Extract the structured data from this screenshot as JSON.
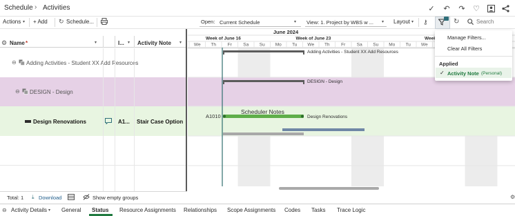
{
  "breadcrumb": {
    "root": "Schedule",
    "separator": "›",
    "current": "Activities"
  },
  "toolbar": {
    "actions": "Actions",
    "add": "+ Add",
    "scheduler": "Schedule...",
    "open_label": "Open:",
    "open_value": "Current Schedule",
    "view_value": "View: 1. Project by WBS w ...",
    "layout": "Layout",
    "search_placeholder": "Search"
  },
  "grid": {
    "col_name": "Name",
    "col_required_mark": "*",
    "col_id": "I...",
    "col_note": "Activity Note",
    "rows": [
      {
        "name": "Adding Activities - Student XX Add Resources",
        "id": "",
        "note": ""
      },
      {
        "name": "DESIGN - Design",
        "id": "",
        "note": ""
      },
      {
        "name": "Design Renovations",
        "id": "A1...",
        "note": "Stair Case Option"
      }
    ]
  },
  "gantt": {
    "month": "June 2024",
    "weeks": [
      "Week of June 16",
      "Week of June 23",
      "Week of"
    ],
    "days": [
      "We",
      "Th",
      "Fr",
      "Sa",
      "Su",
      "Mo",
      "Tu",
      "We",
      "Th",
      "Fr",
      "Sa",
      "Su",
      "Mo",
      "Tu",
      "We",
      "Th",
      "Fr",
      "Sa",
      "Su",
      "Mo"
    ],
    "labels": {
      "bar1": "Adding Activities - Student XX Add Resources",
      "bar2": "DESIGN - Design",
      "bar3": "Design Renovations",
      "act_id": "A1010",
      "note_popup": "Scheduler Notes"
    }
  },
  "footer": {
    "total": "Total: 1",
    "download": "Download",
    "show_empty": "Show empty groups"
  },
  "filter_menu": {
    "manage": "Manage Filters...",
    "clear": "Clear All Filters",
    "applied_header": "Applied",
    "applied_item": "Activity Note",
    "applied_item_suffix": "(Personal)"
  },
  "bottom_tabs": {
    "details": "Activity Details",
    "items": [
      "General",
      "Status",
      "Resource Assignments",
      "Relationships",
      "Scope Assignments",
      "Codes",
      "Tasks",
      "Trace Logic"
    ],
    "active": "Status"
  },
  "colors": {
    "row_design": "#e6d1e6",
    "row_task": "#e8f5e1",
    "bar_dark": "#5b5b5b",
    "bar_green": "#5fae4a",
    "bar_blue": "#6f87a6",
    "bar_gray": "#a8a8a8",
    "accent": "#207a3f",
    "today_line": "#2f6f6f"
  }
}
